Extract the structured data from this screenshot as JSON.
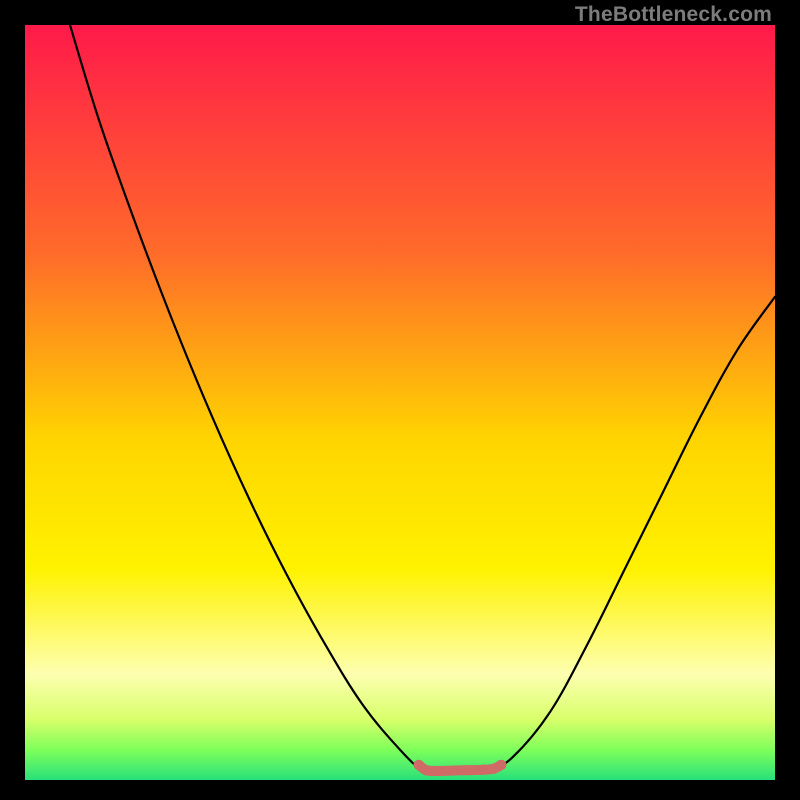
{
  "watermark": "TheBottleneck.com",
  "chart_data": {
    "type": "line",
    "title": "",
    "xlabel": "",
    "ylabel": "",
    "xlim": [
      0,
      100
    ],
    "ylim": [
      0,
      100
    ],
    "gradient_bands": [
      {
        "color": "#ff1a4a",
        "stop": 0
      },
      {
        "color": "#ff6a2a",
        "stop": 30
      },
      {
        "color": "#ffd500",
        "stop": 55
      },
      {
        "color": "#fff200",
        "stop": 72
      },
      {
        "color": "#fdffb0",
        "stop": 86
      },
      {
        "color": "#d8ff6a",
        "stop": 92
      },
      {
        "color": "#7eff5a",
        "stop": 96
      },
      {
        "color": "#28e07a",
        "stop": 100
      }
    ],
    "series": [
      {
        "name": "bottleneck-curve",
        "color": "#000000",
        "points": [
          {
            "x": 6,
            "y": 100
          },
          {
            "x": 10,
            "y": 87
          },
          {
            "x": 15,
            "y": 73
          },
          {
            "x": 20,
            "y": 60
          },
          {
            "x": 25,
            "y": 48
          },
          {
            "x": 30,
            "y": 37
          },
          {
            "x": 35,
            "y": 27
          },
          {
            "x": 40,
            "y": 18
          },
          {
            "x": 45,
            "y": 10
          },
          {
            "x": 50,
            "y": 4
          },
          {
            "x": 53,
            "y": 1.3
          },
          {
            "x": 55,
            "y": 1.2
          },
          {
            "x": 58,
            "y": 1.3
          },
          {
            "x": 60,
            "y": 1.3
          },
          {
            "x": 62,
            "y": 1.4
          },
          {
            "x": 65,
            "y": 3
          },
          {
            "x": 70,
            "y": 9
          },
          {
            "x": 75,
            "y": 18
          },
          {
            "x": 80,
            "y": 28
          },
          {
            "x": 85,
            "y": 38
          },
          {
            "x": 90,
            "y": 48
          },
          {
            "x": 95,
            "y": 57
          },
          {
            "x": 100,
            "y": 64
          }
        ]
      },
      {
        "name": "highlight-segment",
        "color": "#cf6a66",
        "thick": true,
        "points": [
          {
            "x": 52.5,
            "y": 2.0
          },
          {
            "x": 53.5,
            "y": 1.3
          },
          {
            "x": 55,
            "y": 1.2
          },
          {
            "x": 57,
            "y": 1.25
          },
          {
            "x": 59,
            "y": 1.3
          },
          {
            "x": 61,
            "y": 1.35
          },
          {
            "x": 62.5,
            "y": 1.5
          },
          {
            "x": 63.5,
            "y": 2.0
          }
        ]
      }
    ]
  }
}
